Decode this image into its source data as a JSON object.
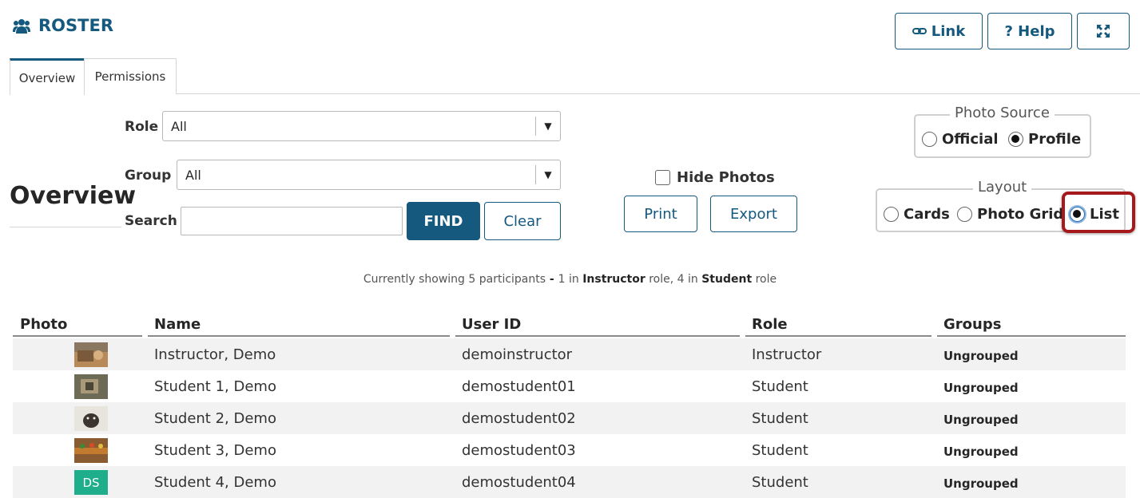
{
  "header": {
    "title": "ROSTER",
    "link_label": "Link",
    "help_label": "? Help"
  },
  "tabs": [
    {
      "label": "Overview",
      "active": true
    },
    {
      "label": "Permissions",
      "active": false
    }
  ],
  "page_heading": "Overview",
  "filters": {
    "role_label": "Role",
    "role_value": "All",
    "group_label": "Group",
    "group_value": "All",
    "search_label": "Search",
    "search_value": "",
    "find_label": "FIND",
    "clear_label": "Clear"
  },
  "display": {
    "hide_photos_label": "Hide Photos",
    "hide_photos_checked": false,
    "print_label": "Print",
    "export_label": "Export"
  },
  "photo_source": {
    "legend": "Photo Source",
    "options": [
      "Official",
      "Profile"
    ],
    "selected": "Profile"
  },
  "layout": {
    "legend": "Layout",
    "options": [
      "Cards",
      "Photo Grid",
      "List"
    ],
    "selected": "List"
  },
  "summary": {
    "prefix": "Currently showing 5 participants",
    "sep": " - ",
    "count1": "1 in ",
    "role1": "Instructor",
    "mid": " role, 4 in ",
    "role2": "Student",
    "suffix": " role"
  },
  "table": {
    "columns": [
      "Photo",
      "Name",
      "User ID",
      "Role",
      "Groups"
    ],
    "rows": [
      {
        "photo": "photo-1",
        "name": "Instructor, Demo",
        "user_id": "demoinstructor",
        "role": "Instructor",
        "groups": "Ungrouped"
      },
      {
        "photo": "photo-2",
        "name": "Student 1, Demo",
        "user_id": "demostudent01",
        "role": "Student",
        "groups": "Ungrouped"
      },
      {
        "photo": "photo-3",
        "name": "Student 2, Demo",
        "user_id": "demostudent02",
        "role": "Student",
        "groups": "Ungrouped"
      },
      {
        "photo": "photo-4",
        "name": "Student 3, Demo",
        "user_id": "demostudent03",
        "role": "Student",
        "groups": "Ungrouped"
      },
      {
        "photo": "initials-avatar",
        "initials": "DS",
        "name": "Student 4, Demo",
        "user_id": "demostudent04",
        "role": "Student",
        "groups": "Ungrouped"
      }
    ]
  },
  "colors": {
    "brand": "#15597e",
    "highlight": "#a5191d",
    "avatar": "#1fae8c"
  }
}
